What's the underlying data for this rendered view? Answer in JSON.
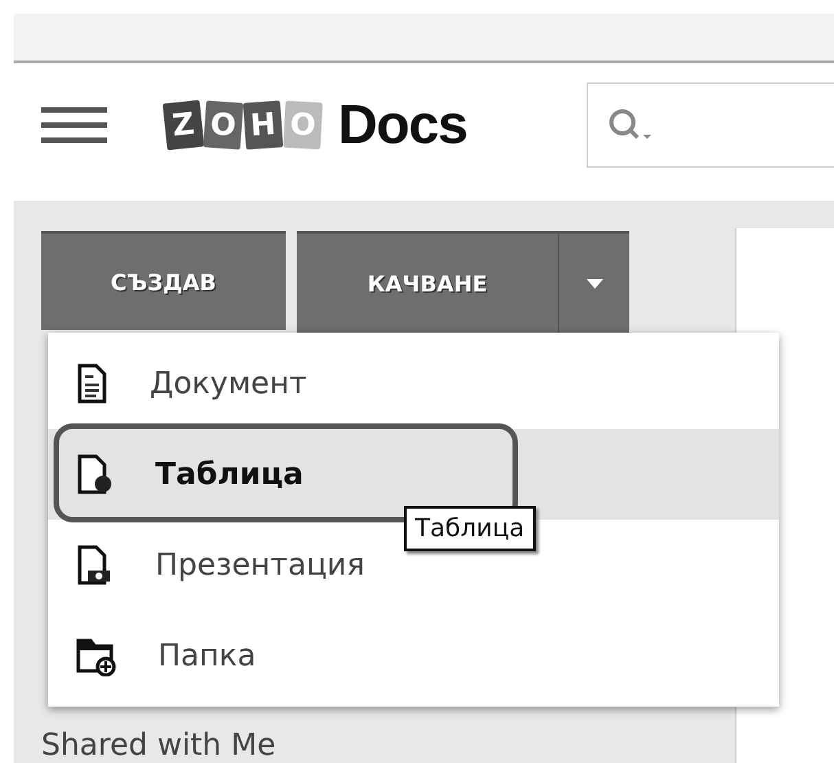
{
  "header": {
    "logo_letters": [
      "Z",
      "O",
      "H",
      "O"
    ],
    "app_name": "Docs"
  },
  "toolbar": {
    "buttons": [
      {
        "label": "СЪЗДАВ",
        "kind": "primary"
      },
      {
        "label": "КАЧВАНЕ",
        "kind": "split"
      }
    ]
  },
  "menu": {
    "items": [
      {
        "label": "Документ",
        "kind": "document",
        "selected": false
      },
      {
        "label": "Таблица",
        "kind": "spreadsheet",
        "selected": true
      },
      {
        "label": "Презентация",
        "kind": "presentation",
        "selected": false
      },
      {
        "label": "Папка",
        "kind": "folder",
        "selected": false
      }
    ]
  },
  "tooltip": "Таблица",
  "sidebar": {
    "items": [
      "Shared with Me"
    ]
  }
}
